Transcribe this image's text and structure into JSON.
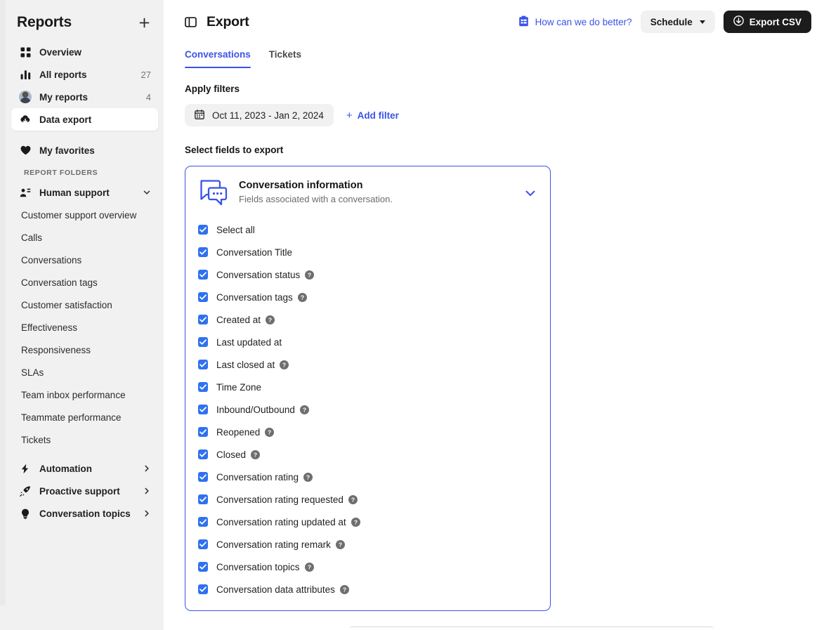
{
  "colors": {
    "accent": "#3b53e8",
    "checkbox": "#2f71f0",
    "sidebar_bg": "#f1f1f1",
    "primary_button_bg": "#1c1c1c",
    "muted_text": "#6b6b6b"
  },
  "sidebar": {
    "title": "Reports",
    "add_label": "+",
    "nav": [
      {
        "label": "Overview",
        "icon": "grid-icon",
        "count": "",
        "active": false
      },
      {
        "label": "All reports",
        "icon": "bar-chart-icon",
        "count": "27",
        "active": false
      },
      {
        "label": "My reports",
        "icon": "avatar-icon",
        "count": "4",
        "active": false
      },
      {
        "label": "Data export",
        "icon": "cloud-download-icon",
        "count": "",
        "active": true
      },
      {
        "label": "My favorites",
        "icon": "heart-icon",
        "count": "",
        "active": false
      }
    ],
    "section_title": "REPORT FOLDERS",
    "folders": [
      {
        "label": "Human support",
        "icon": "agent-icon",
        "chevron": "chevron-down-icon",
        "expanded": true,
        "children": [
          "Customer support overview",
          "Calls",
          "Conversations",
          "Conversation tags",
          "Customer satisfaction",
          "Effectiveness",
          "Responsiveness",
          "SLAs",
          "Team inbox performance",
          "Teammate performance",
          "Tickets"
        ]
      },
      {
        "label": "Automation",
        "icon": "lightning-icon",
        "chevron": "chevron-right-icon",
        "expanded": false,
        "children": []
      },
      {
        "label": "Proactive support",
        "icon": "rocket-icon",
        "chevron": "chevron-right-icon",
        "expanded": false,
        "children": []
      },
      {
        "label": "Conversation topics",
        "icon": "lightbulb-icon",
        "chevron": "chevron-right-icon",
        "expanded": false,
        "children": []
      }
    ]
  },
  "header": {
    "panel_toggle_icon": "panel-toggle-icon",
    "title": "Export",
    "feedback": {
      "icon": "clipboard-icon",
      "label": "How can we do better?"
    },
    "schedule_button": "Schedule",
    "export_button": "Export CSV",
    "export_icon": "download-circle-icon"
  },
  "tabs": [
    {
      "label": "Conversations",
      "active": true
    },
    {
      "label": "Tickets",
      "active": false
    }
  ],
  "filters": {
    "label": "Apply filters",
    "date_range": "Oct 11, 2023 - Jan 2, 2024",
    "date_icon": "calendar-icon",
    "add_filter": "Add filter",
    "add_filter_plus": "+"
  },
  "fields_section": {
    "label": "Select fields to export",
    "card": {
      "icon": "conversation-bubbles-icon",
      "title": "Conversation information",
      "subtitle": "Fields associated with a conversation.",
      "collapse_icon": "chevron-down-icon",
      "fields": [
        {
          "label": "Select all",
          "checked": true,
          "help": false
        },
        {
          "label": "Conversation Title",
          "checked": true,
          "help": false
        },
        {
          "label": "Conversation status",
          "checked": true,
          "help": true
        },
        {
          "label": "Conversation tags",
          "checked": true,
          "help": true
        },
        {
          "label": "Created at",
          "checked": true,
          "help": true
        },
        {
          "label": "Last updated at",
          "checked": true,
          "help": false
        },
        {
          "label": "Last closed at",
          "checked": true,
          "help": true
        },
        {
          "label": "Time Zone",
          "checked": true,
          "help": false
        },
        {
          "label": "Inbound/Outbound",
          "checked": true,
          "help": true
        },
        {
          "label": "Reopened",
          "checked": true,
          "help": true
        },
        {
          "label": "Closed",
          "checked": true,
          "help": true
        },
        {
          "label": "Conversation rating",
          "checked": true,
          "help": true
        },
        {
          "label": "Conversation rating requested",
          "checked": true,
          "help": true
        },
        {
          "label": "Conversation rating updated at",
          "checked": true,
          "help": true
        },
        {
          "label": "Conversation rating remark",
          "checked": true,
          "help": true
        },
        {
          "label": "Conversation topics",
          "checked": true,
          "help": true
        },
        {
          "label": "Conversation data attributes",
          "checked": true,
          "help": true
        }
      ]
    }
  }
}
